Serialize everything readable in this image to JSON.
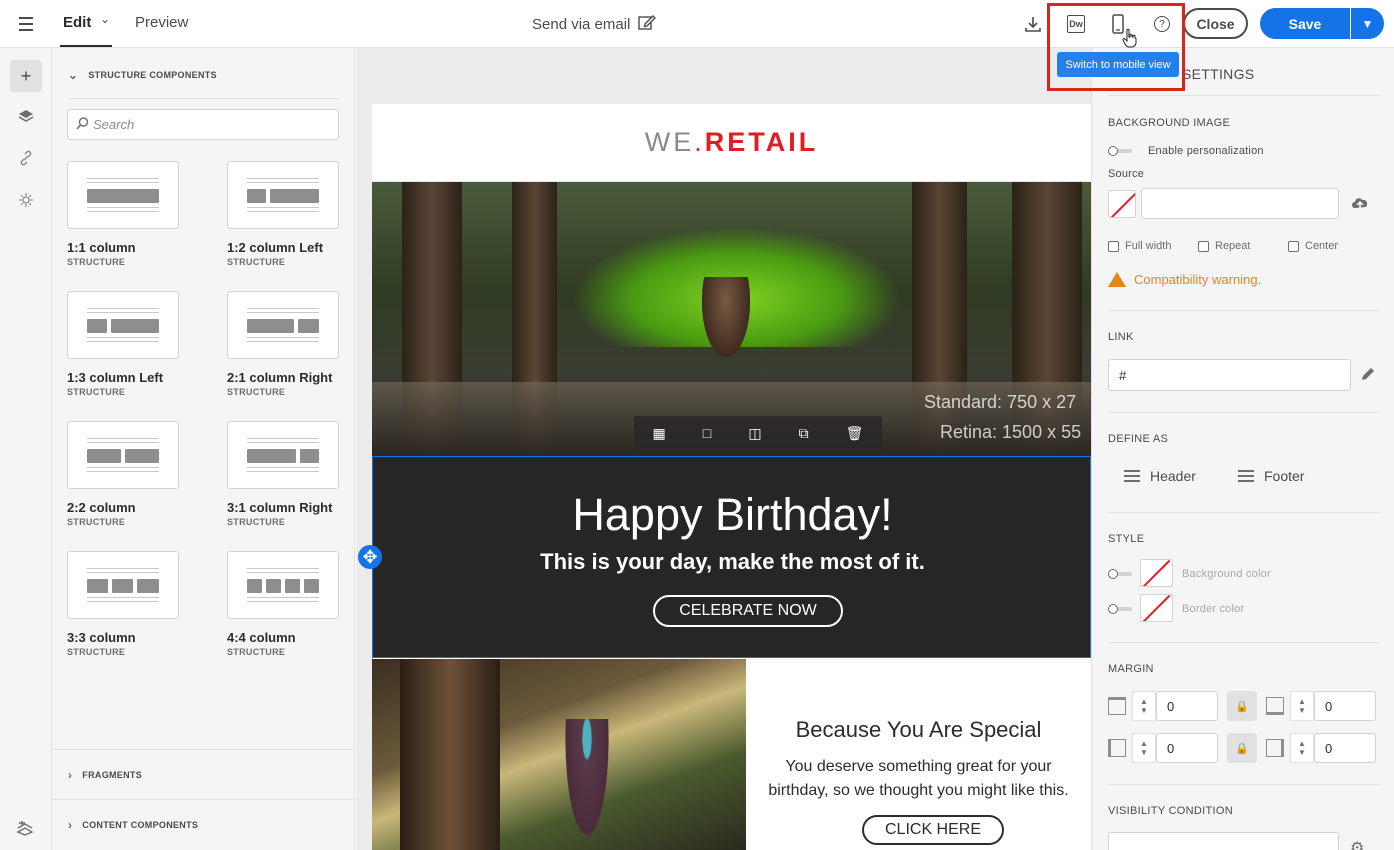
{
  "topbar": {
    "tab_edit": "Edit",
    "tab_preview": "Preview",
    "title": "Send via email",
    "tooltip": "Switch to mobile view",
    "close_label": "Close",
    "save_label": "Save",
    "dw_label": "Dw",
    "help_label": "?"
  },
  "components": {
    "section_structure": "STRUCTURE COMPONENTS",
    "search_placeholder": "Search",
    "items": [
      {
        "name": "1:1 column",
        "type": "STRUCTURE"
      },
      {
        "name": "1:2 column Left",
        "type": "STRUCTURE"
      },
      {
        "name": "1:3 column Left",
        "type": "STRUCTURE"
      },
      {
        "name": "2:1 column Right",
        "type": "STRUCTURE"
      },
      {
        "name": "2:2 column",
        "type": "STRUCTURE"
      },
      {
        "name": "3:1 column Right",
        "type": "STRUCTURE"
      },
      {
        "name": "3:3 column",
        "type": "STRUCTURE"
      },
      {
        "name": "4:4 column",
        "type": "STRUCTURE"
      }
    ],
    "section_fragments": "FRAGMENTS",
    "section_content": "CONTENT COMPONENTS"
  },
  "email": {
    "logo_we": "WE",
    "logo_dot": ".",
    "logo_retail": "RETAIL",
    "hero_standard": "Standard: 750 x 27",
    "hero_retina": "Retina: 1500 x 55",
    "birthday_title": "Happy Birthday!",
    "birthday_sub": "This is your day, make the most of it.",
    "birthday_btn": "CELEBRATE NOW",
    "special_title": "Because You Are Special",
    "special_text": "You deserve something great for your birthday, so we thought you might like this.",
    "special_btn": "CLICK HERE"
  },
  "settings": {
    "header": "SETTINGS",
    "bg_image": "BACKGROUND IMAGE",
    "enable_personalization": "Enable personalization",
    "source": "Source",
    "full_width": "Full width",
    "repeat": "Repeat",
    "center": "Center",
    "compat_warning": "Compatibility warning.",
    "link": "LINK",
    "link_value": "#",
    "define_as": "DEFINE AS",
    "header_btn": "Header",
    "footer_btn": "Footer",
    "style": "STYLE",
    "bg_color": "Background color",
    "border_color": "Border color",
    "margin": "MARGIN",
    "margin_top": "0",
    "margin_bottom": "0",
    "margin_left": "0",
    "margin_right": "0",
    "visibility": "VISIBILITY CONDITION"
  },
  "colors": {
    "accent": "#1473e6",
    "tooltip": "#2680eb",
    "highlight": "#d9251d",
    "warning": "#e68619",
    "brand_red": "#e31b23"
  }
}
